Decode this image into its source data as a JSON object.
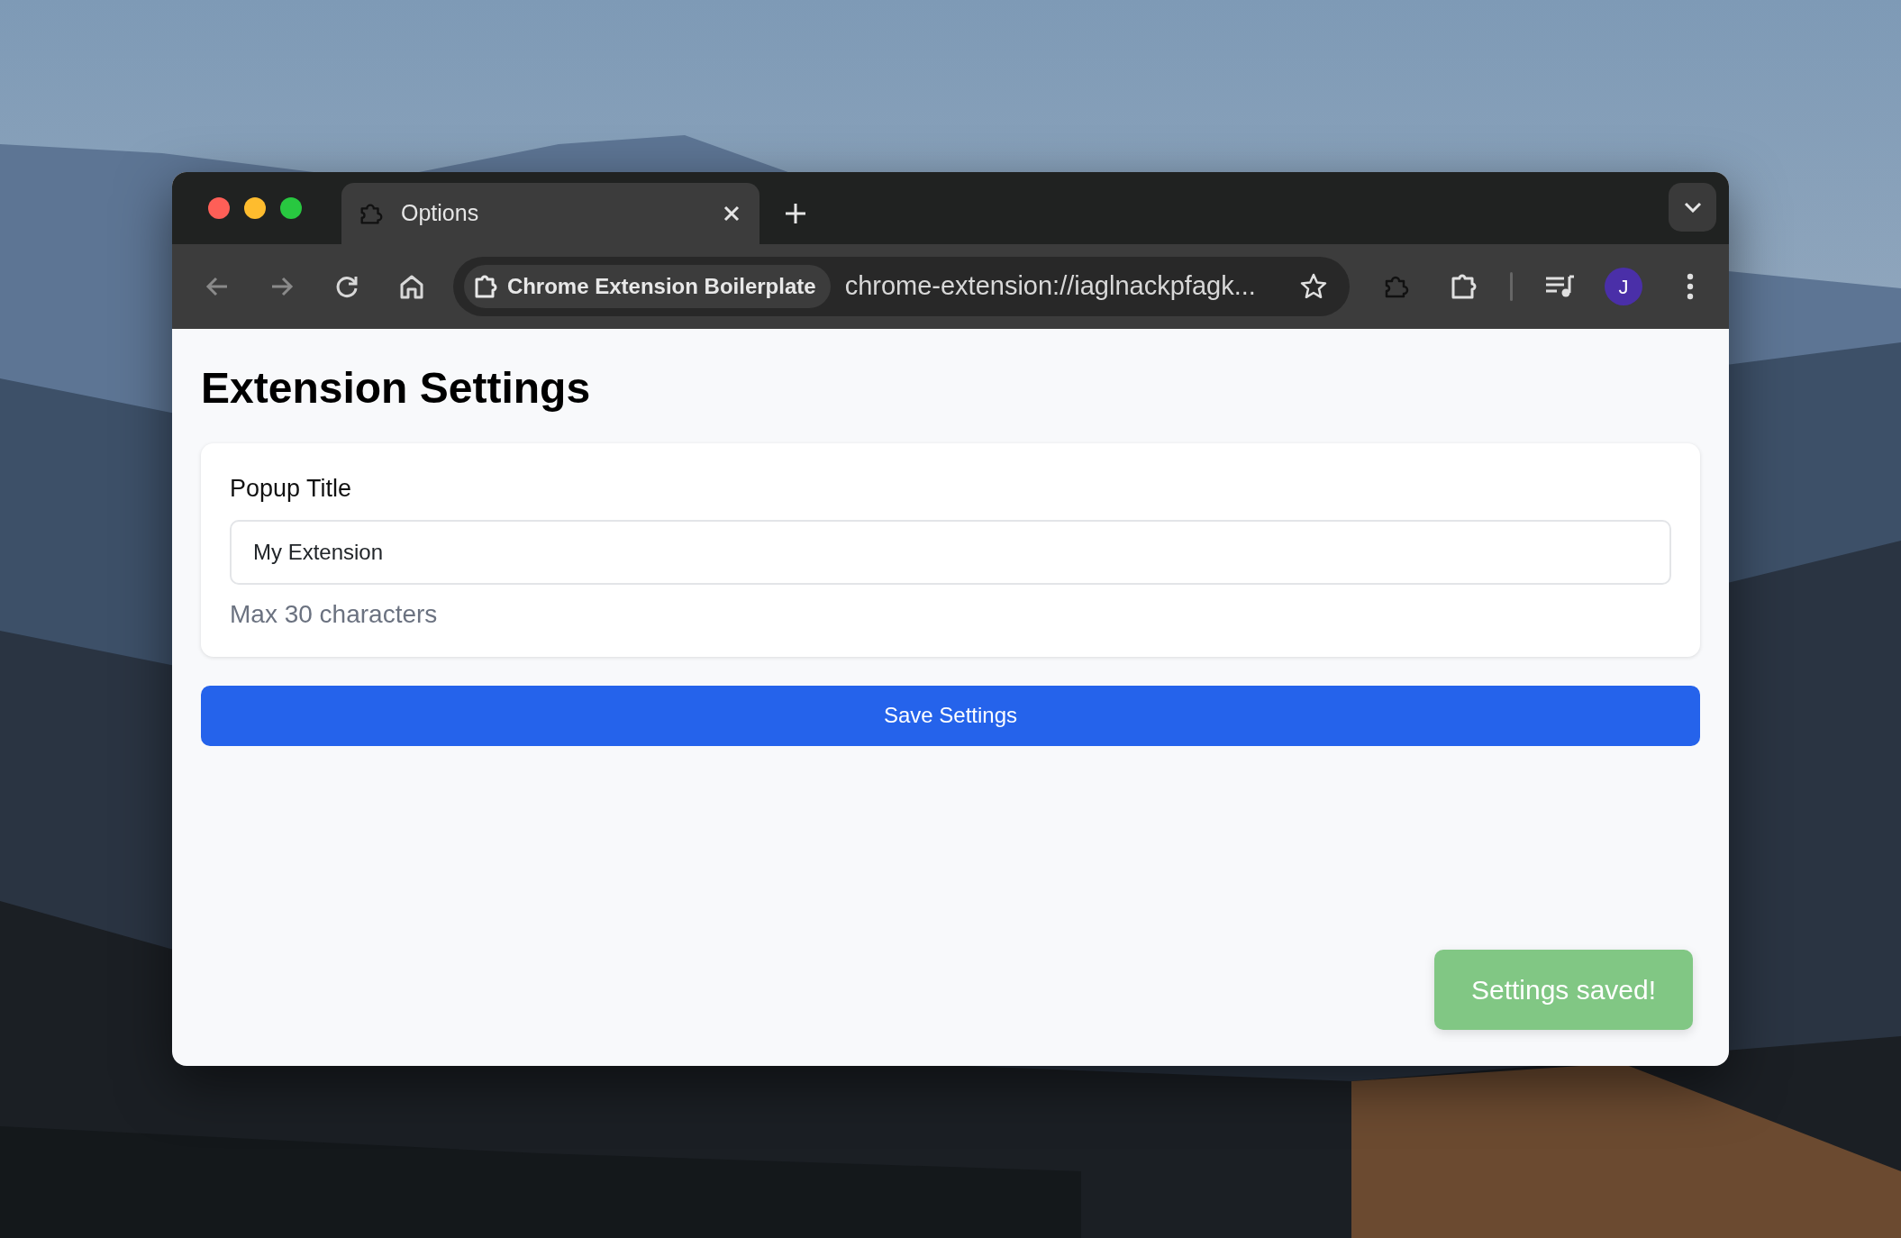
{
  "tabs": [
    {
      "title": "Options",
      "selected": true
    }
  ],
  "toolbar": {
    "extension_chip": "Chrome Extension Boilerplate",
    "url": "chrome-extension://iaglnackpfagk...",
    "avatar": "J"
  },
  "page": {
    "heading": "Extension Settings",
    "field": {
      "label": "Popup Title",
      "value": "My Extension",
      "help": "Max 30 characters"
    },
    "save_button": "Save Settings"
  },
  "toast": {
    "text": "Settings saved!"
  }
}
